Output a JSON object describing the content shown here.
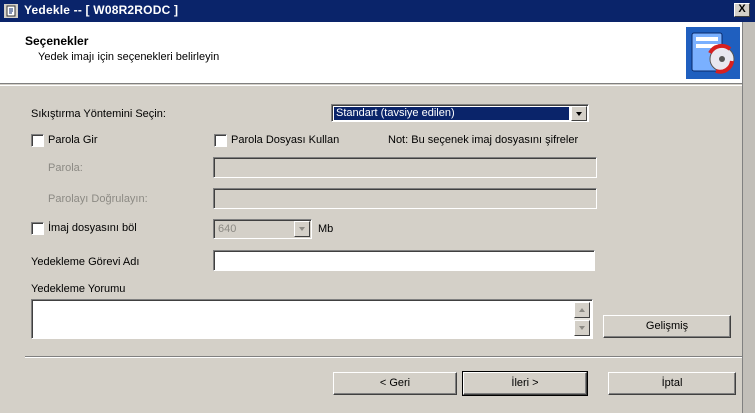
{
  "window": {
    "title": "Yedekle -- [ W08R2RODC ]",
    "close_label": "X"
  },
  "header": {
    "title": "Seçenekler",
    "subtitle": "Yedek imajı için seçenekleri belirleyin"
  },
  "form": {
    "compression_label": "Sıkıştırma Yöntemini Seçin:",
    "compression_value": "Standart (tavsiye edilen)",
    "password_checkbox_label": "Parola Gir",
    "password_file_checkbox_label": "Parola Dosyası Kullan",
    "encrypt_note": "Not: Bu seçenek imaj dosyasını şifreler",
    "password_label": "Parola:",
    "password_value": "",
    "confirm_password_label": "Parolayı Doğrulayın:",
    "confirm_password_value": "",
    "split_checkbox_label": "İmaj dosyasını böl",
    "split_size_value": "640",
    "split_unit": "Mb",
    "task_name_label": "Yedekleme Görevi Adı",
    "task_name_value": "",
    "comment_label": "Yedekleme Yorumu",
    "comment_value": ""
  },
  "buttons": {
    "advanced": "Gelişmiş",
    "back": "< Geri",
    "next": "İleri >",
    "cancel": "İptal"
  }
}
